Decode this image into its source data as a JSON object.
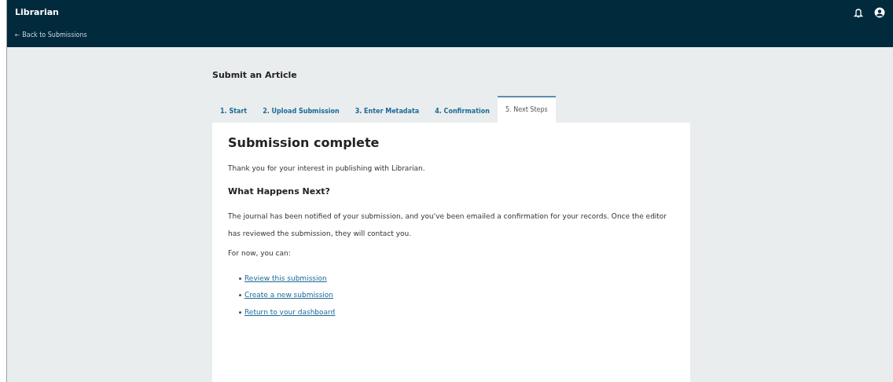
{
  "header": {
    "site_title": "Librarian",
    "back_link": "← Back to Submissions"
  },
  "page_title": "Submit an Article",
  "tabs": [
    {
      "label": "1. Start",
      "selected": false
    },
    {
      "label": "2. Upload Submission",
      "selected": false
    },
    {
      "label": "3. Enter Metadata",
      "selected": false
    },
    {
      "label": "4. Confirmation",
      "selected": false
    },
    {
      "label": "5. Next Steps",
      "selected": true
    }
  ],
  "card": {
    "heading": "Submission complete",
    "intro": "Thank you for your interest in publishing with Librarian.",
    "subheading": "What Happens Next?",
    "body": "The journal has been notified of your submission, and you've been emailed a confirmation for your records. Once the editor has reviewed the submission, they will contact you.",
    "lead": "For now, you can:",
    "links": [
      "Review this submission",
      "Create a new submission",
      "Return to your dashboard"
    ]
  }
}
